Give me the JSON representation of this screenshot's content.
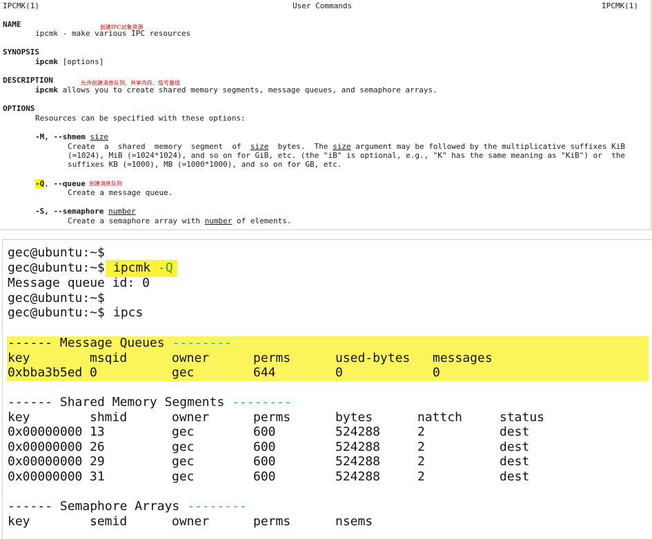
{
  "man": {
    "header_left": "IPCMK(1)",
    "header_center": "User Commands",
    "header_right": "IPCMK(1)",
    "name_heading": "NAME",
    "name_line": "ipcmk - make various IPC resources",
    "name_note": "创建IPC对象资源",
    "synopsis_heading": "SYNOPSIS",
    "synopsis_cmd": "ipcmk",
    "synopsis_args": " [options]",
    "description_heading": "DESCRIPTION",
    "description_note": "允许创建消息队列、共享内存、信号量组",
    "description_cmd": "ipcmk",
    "description_text": " allows you to create shared memory segments, message queues, and semaphore arrays.",
    "options_heading": "OPTIONS",
    "options_intro": "Resources can be specified with these options:",
    "opt_m_flag": "-M, --shmem",
    "opt_m_arg": "size",
    "opt_m_l1a": "Create  a  shared  memory  segment  of  ",
    "opt_m_l1b": "size",
    "opt_m_l1c": "  bytes.  The ",
    "opt_m_l1d": "size",
    "opt_m_l1e": " argument may be followed by the multiplicative suffixes KiB",
    "opt_m_l2": "(=1024), MiB (=1024*1024), and so on for GiB, etc. (the \"iB\" is optional, e.g., \"K\" has the same meaning as \"KiB\") or  the",
    "opt_m_l3": "suffixes KB (=1000), MB (=1000*1000), and so on for GB, etc.",
    "opt_q_short": "-Q",
    "opt_q_sep": ", ",
    "opt_q_long": "--queue",
    "opt_q_note": "创建消息队列",
    "opt_q_desc": "Create a message queue.",
    "opt_s_flag": "-S, --semaphore",
    "opt_s_arg": "number",
    "opt_s_d1": "Create a semaphore array with ",
    "opt_s_d2": "number",
    "opt_s_d3": " of elements."
  },
  "terminal": {
    "prompt": "gec@ubuntu:~$",
    "cmd_ipcmk": "ipcmk",
    "cmd_ipcmk_arg": "-Q",
    "result": "Message queue id: 0",
    "cmd_ipcs": "ipcs",
    "mq": {
      "title_dashes": "------",
      "title": "Message Queues",
      "title_trail": "--------",
      "headers": [
        "key",
        "msqid",
        "owner",
        "perms",
        "used-bytes",
        "messages"
      ],
      "rows": [
        [
          "0xbba3b5ed",
          "0",
          "gec",
          "644",
          "0",
          "0"
        ]
      ]
    },
    "shm": {
      "title_dashes": "------",
      "title": "Shared Memory Segments",
      "title_trail": "--------",
      "headers": [
        "key",
        "shmid",
        "owner",
        "perms",
        "bytes",
        "nattch",
        "status"
      ],
      "rows": [
        [
          "0x00000000",
          "13",
          "gec",
          "600",
          "524288",
          "2",
          "dest"
        ],
        [
          "0x00000000",
          "26",
          "gec",
          "600",
          "524288",
          "2",
          "dest"
        ],
        [
          "0x00000000",
          "29",
          "gec",
          "600",
          "524288",
          "2",
          "dest"
        ],
        [
          "0x00000000",
          "31",
          "gec",
          "600",
          "524288",
          "2",
          "dest"
        ]
      ]
    },
    "sem": {
      "title_dashes": "------",
      "title": "Semaphore Arrays",
      "title_trail": "--------",
      "headers": [
        "key",
        "semid",
        "owner",
        "perms",
        "nsems"
      ]
    }
  },
  "colors": {
    "highlight": "#fff33a",
    "note_red": "#e00000",
    "trail_cyan": "#1ab0c8",
    "arg_green": "#3a9a3a"
  }
}
